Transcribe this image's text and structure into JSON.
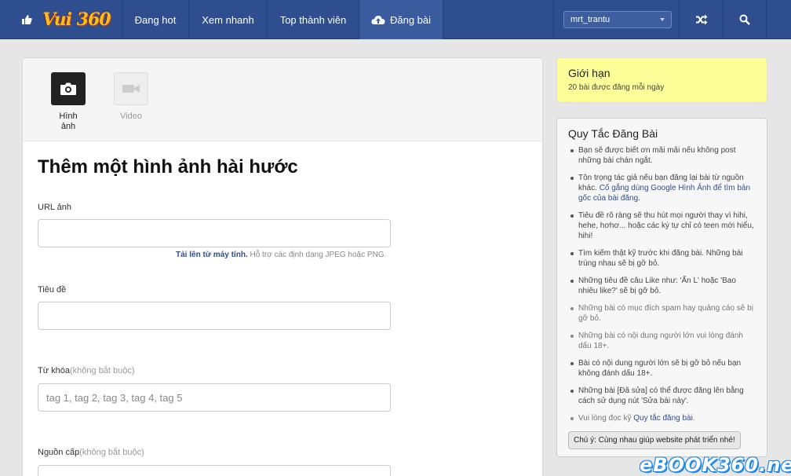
{
  "header": {
    "logo_text": "Vui 360",
    "nav": [
      "Đang hot",
      "Xem nhanh",
      "Top thành viên",
      "Đăng bài"
    ],
    "user": "mrt_trantu"
  },
  "upload": {
    "types": [
      {
        "label": "Hình ảnh",
        "icon": "camera-icon",
        "active": true
      },
      {
        "label": "Video",
        "icon": "video-icon",
        "active": false
      }
    ],
    "title": "Thêm một hình ảnh hài hước",
    "url_label": "URL ảnh",
    "upload_link": "Tải lên từ máy tính.",
    "upload_help": " Hỗ trợ các định dạng JPEG hoặc PNG.",
    "title_label": "Tiêu đề",
    "tags_label": "Từ khóa",
    "tags_optional": "(không bắt buộc)",
    "tags_placeholder": "tag 1, tag 2, tag 3, tag 4, tag 5",
    "source_label": "Nguồn cấp",
    "source_optional": "(không bắt buộc)"
  },
  "limit": {
    "title": "Giới hạn",
    "text": "20 bài được đăng mỗi ngày"
  },
  "rules": {
    "title": "Quy Tắc Đăng Bài",
    "items": [
      "Bạn sẽ được biết ơn mãi mãi nếu không post những bài chán ngắt.",
      "Tôn trọng tác giả nếu bạn đăng lại bài từ nguồn khác.",
      "Tiêu đề rõ ràng sẽ thu hút mọi người thay vì hihi, hehe, hơhơ... hoặc các ký tự chỉ có teen mới hiểu, hihi!",
      "Tìm kiếm thật kỹ trước khi đăng bài. Những bài trùng nhau sẽ bị gỡ bỏ.",
      "Những tiêu đề câu Like như: 'Ấn L' hoặc 'Bao nhiêu like?' sẽ bị gỡ bỏ.",
      "Những bài có mục đích spam hay quảng cáo sẽ bị gỡ bỏ.",
      "Những bài có nội dung người lớn vui lòng đánh dấu 18+.",
      "Bài có nội dung người lớn sẽ bị gỡ bỏ nếu bạn không đánh dấu 18+.",
      "Những bài [Đã sửa] có thể được đăng lên bằng cách sử dụng nút 'Sửa bài này'.",
      "Vui lòng đọc kỹ "
    ],
    "item2_link": "Cố gắng dùng Google Hình Ảnh để tìm bản gốc của bài đăng.",
    "last_link": "Quy tắc đăng bài",
    "last_end": ".",
    "note": "Chú ý: Cùng nhau giúp website phát triển nhé!"
  },
  "watermark": "eBOOK360.neT"
}
